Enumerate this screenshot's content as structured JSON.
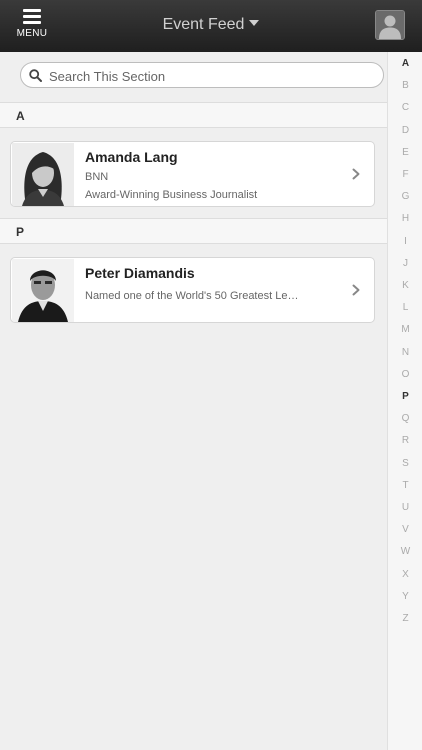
{
  "topbar": {
    "menu_label": "MENU",
    "title": "Event Feed"
  },
  "search": {
    "placeholder": "Search This Section",
    "value": ""
  },
  "sections": [
    {
      "letter": "A",
      "people": [
        {
          "name": "Amanda Lang",
          "line1": "BNN",
          "line2": "Award-Winning Business Journalist"
        }
      ]
    },
    {
      "letter": "P",
      "people": [
        {
          "name": "Peter Diamandis",
          "line1": "Named one of the World's 50 Greatest Le…"
        }
      ]
    }
  ],
  "alpha_index": [
    "A",
    "B",
    "C",
    "D",
    "E",
    "F",
    "G",
    "H",
    "I",
    "J",
    "K",
    "L",
    "M",
    "N",
    "O",
    "P",
    "Q",
    "R",
    "S",
    "T",
    "U",
    "V",
    "W",
    "X",
    "Y",
    "Z"
  ],
  "alpha_active": [
    "A",
    "P"
  ],
  "colors": {
    "topbar": "#2a2a2a",
    "background": "#efefef",
    "index_active": "#333333",
    "index_inactive": "#aaaaaa"
  },
  "icons": {
    "menu": "hamburger-icon",
    "title_dropdown": "caret-down-icon",
    "profile": "user-silhouette-icon",
    "search": "magnifier-icon",
    "row_disclosure": "chevron-right-icon"
  }
}
